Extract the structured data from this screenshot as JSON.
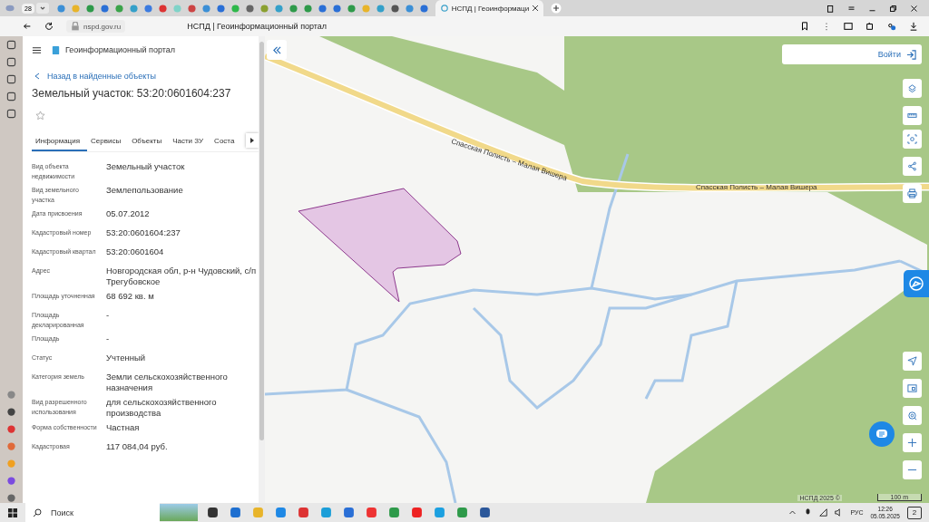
{
  "browser": {
    "tab_count": "28",
    "tabs": [
      {
        "title": "НСПД | Геоинформаци",
        "selected": true
      }
    ],
    "url": "nspd.gov.ru",
    "page_title": "НСПД | Геоинформационный портал"
  },
  "portal": {
    "title": "Геоинформационный портал",
    "back_link": "Назад в найденные объекты",
    "heading": "Земельный участок: 53:20:0601604:237",
    "tabs": [
      {
        "label": "Информация",
        "selected": true
      },
      {
        "label": "Сервисы",
        "selected": false
      },
      {
        "label": "Объекты",
        "selected": false
      },
      {
        "label": "Части ЗУ",
        "selected": false
      },
      {
        "label": "Соста",
        "selected": false
      }
    ],
    "fields": [
      {
        "label": "Вид объекта недвижимости",
        "value": "Земельный участок"
      },
      {
        "label": "Вид земельного участка",
        "value": "Землепользование"
      },
      {
        "label": "Дата присвоения",
        "value": "05.07.2012"
      },
      {
        "label": "Кадастровый номер",
        "value": "53:20:0601604:237"
      },
      {
        "label": "Кадастровый квартал",
        "value": "53:20:0601604"
      },
      {
        "label": "Адрес",
        "value": "Новгородская обл, р-н Чудовский, с/п Трегубовское"
      },
      {
        "label": "Площадь уточненная",
        "value": "68 692 кв. м"
      },
      {
        "label": "Площадь декларированная",
        "value": "-"
      },
      {
        "label": "Площадь",
        "value": "-"
      },
      {
        "label": "Статус",
        "value": "Учтенный"
      },
      {
        "label": "Категория земель",
        "value": "Земли сельскохозяйственного назначения"
      },
      {
        "label": "Вид разрешенного использования",
        "value": "для сельскохозяйственного производства"
      },
      {
        "label": "Форма собственности",
        "value": "Частная"
      },
      {
        "label": "Кадастровая",
        "value": "117 084,04 руб."
      }
    ]
  },
  "map": {
    "login": "Войти",
    "road_labels": [
      "Спасская Полисть – Малая Вишера",
      "Спасская Полисть – Малая Вишера"
    ],
    "attribution": "НСПД 2025 ©",
    "scale": "100 m"
  },
  "taskbar": {
    "search_placeholder": "Поиск",
    "language": "РУС",
    "time": "12:26",
    "date": "05.05.2025",
    "notifications": "2"
  }
}
